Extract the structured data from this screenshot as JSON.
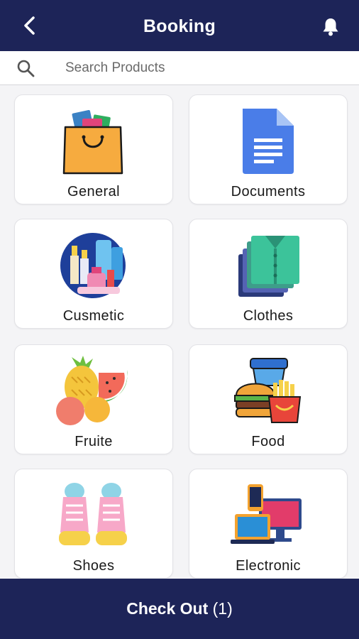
{
  "header": {
    "title": "Booking",
    "back_icon": "chevron-left-icon",
    "bell_icon": "bell-icon",
    "color": "#1d2458"
  },
  "search": {
    "placeholder": "Search Products",
    "icon": "search-icon"
  },
  "categories": [
    {
      "label": "General",
      "icon": "shopping-bag-icon"
    },
    {
      "label": "Documents",
      "icon": "document-icon"
    },
    {
      "label": "Cusmetic",
      "icon": "cosmetics-icon"
    },
    {
      "label": "Clothes",
      "icon": "shirts-icon"
    },
    {
      "label": "Fruite",
      "icon": "fruits-icon"
    },
    {
      "label": "Food",
      "icon": "fast-food-icon"
    },
    {
      "label": "Shoes",
      "icon": "sneakers-icon"
    },
    {
      "label": "Electronic",
      "icon": "devices-icon"
    }
  ],
  "checkout": {
    "label": "Check Out",
    "count": "(1)"
  }
}
